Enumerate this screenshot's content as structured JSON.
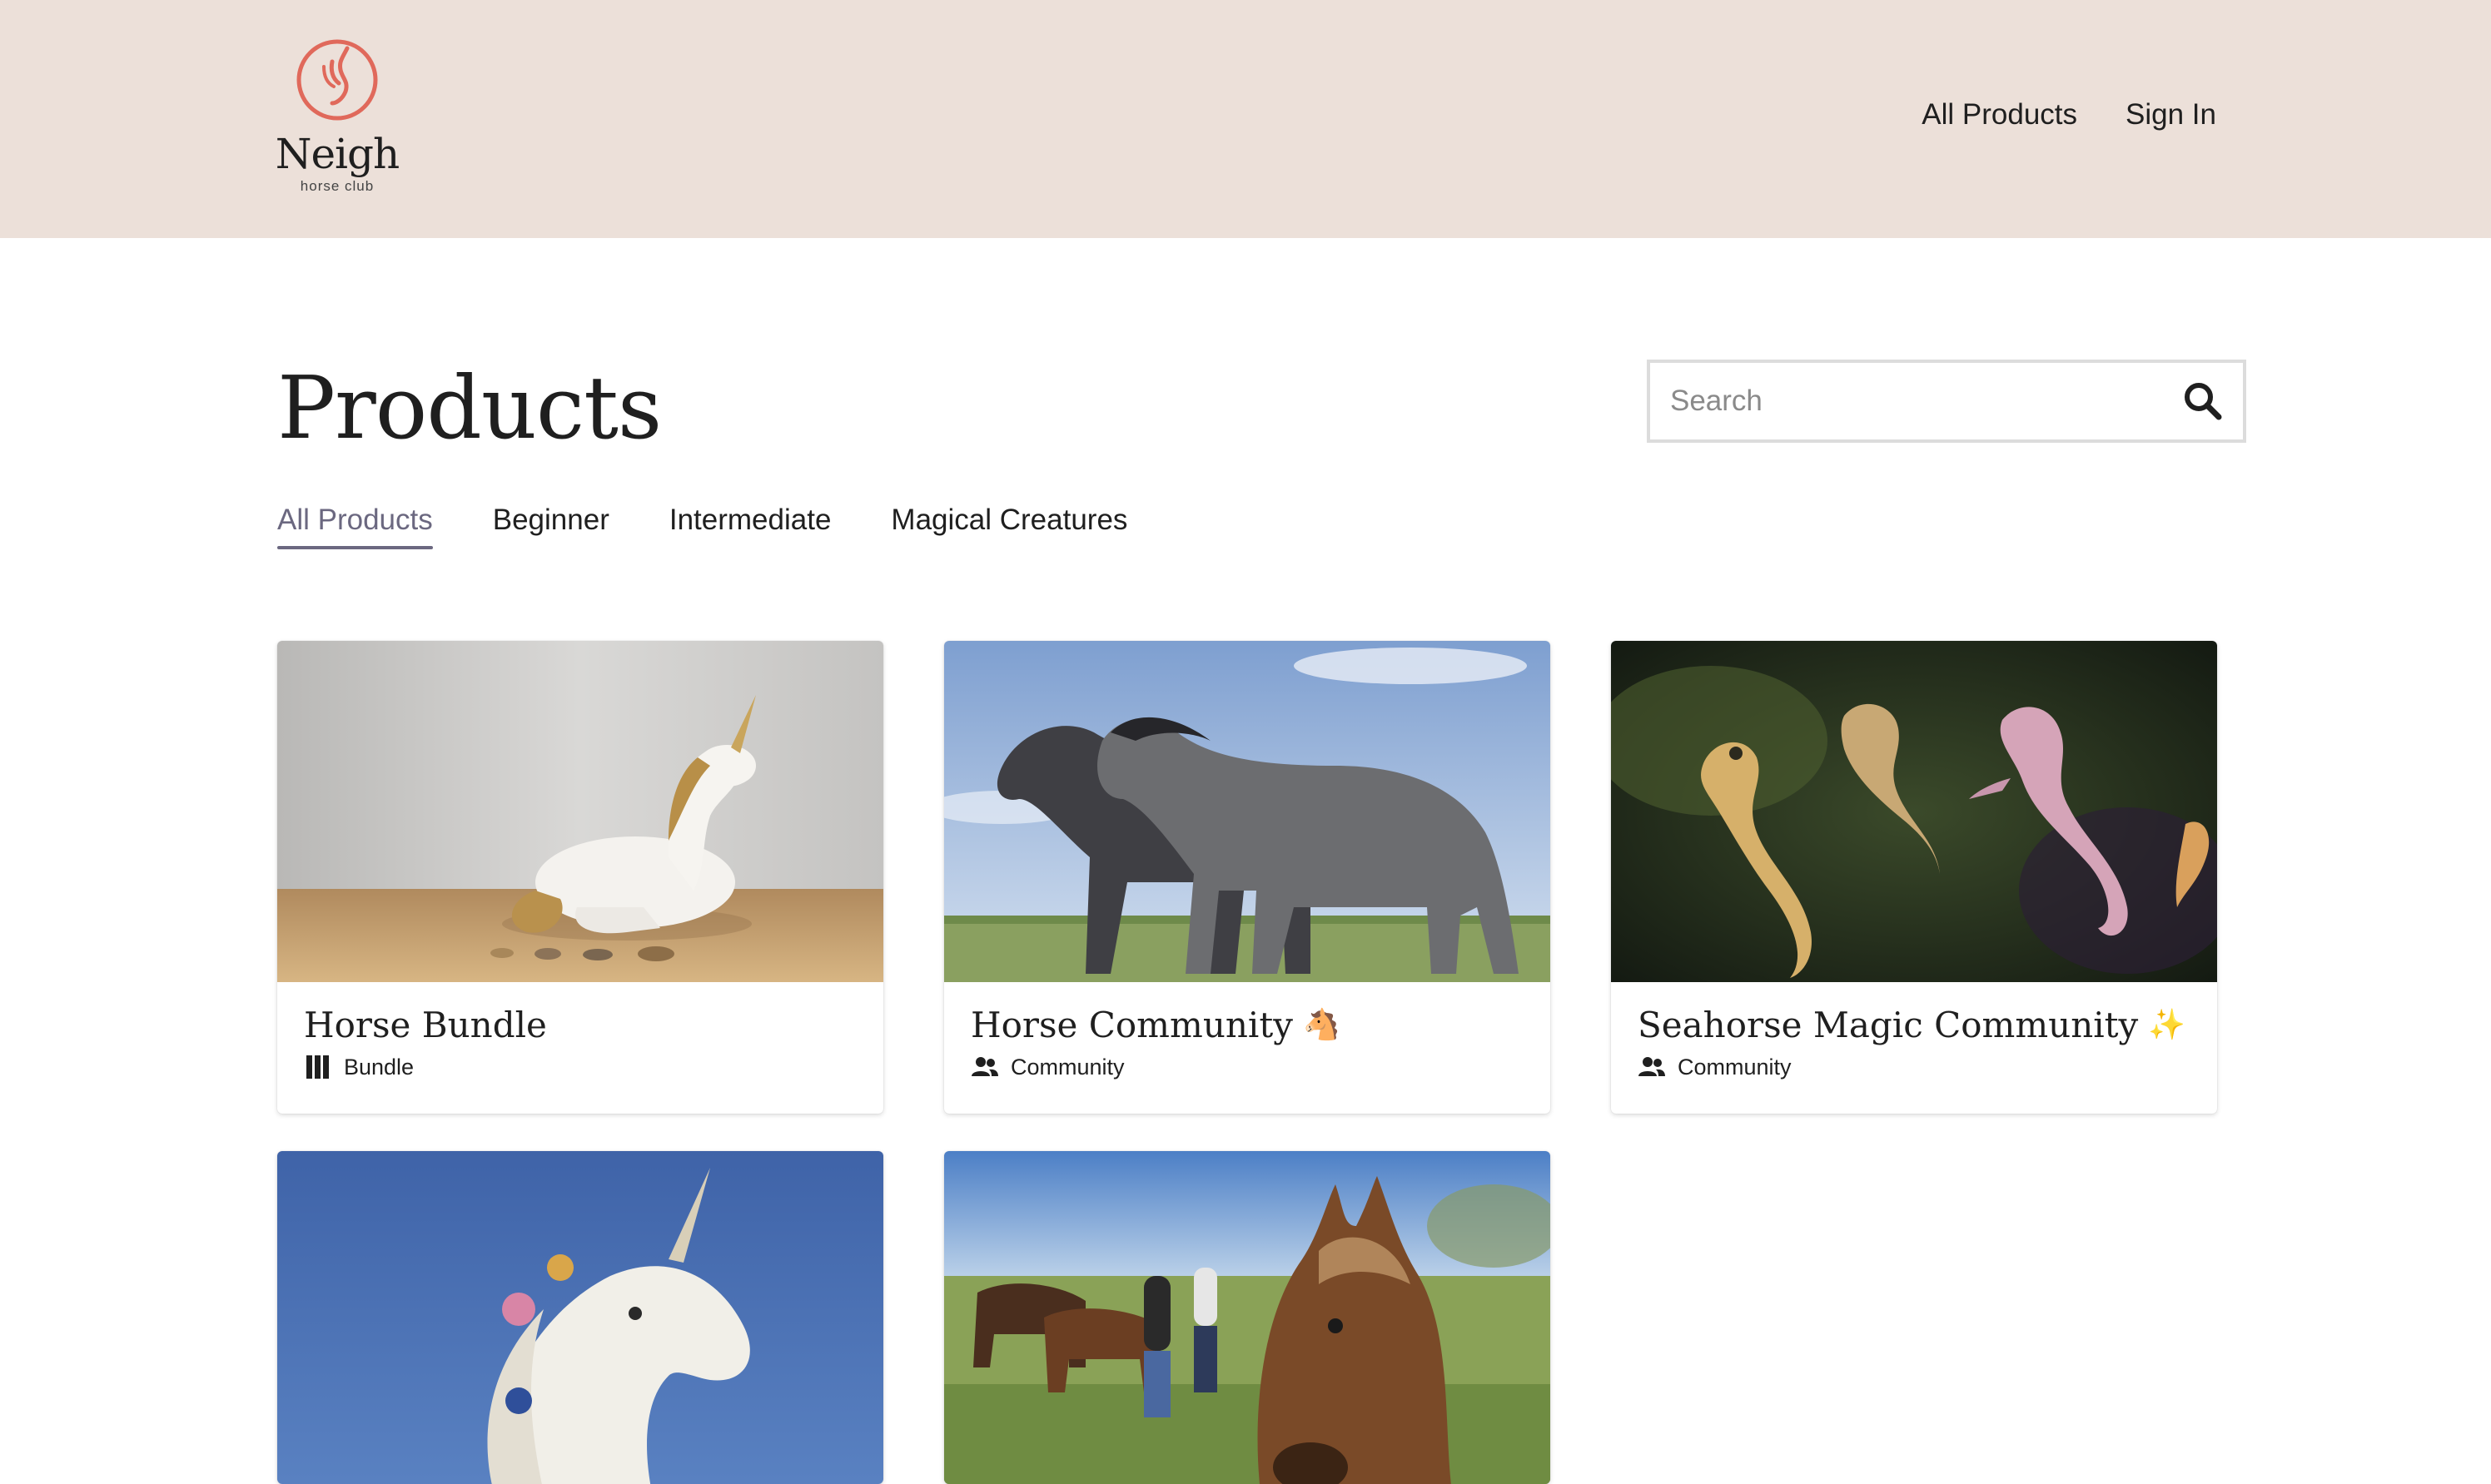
{
  "brand": {
    "name": "Neigh",
    "tagline": "horse club",
    "accent": "#e0695b"
  },
  "top_nav": {
    "items": [
      "All Products",
      "Sign In"
    ]
  },
  "page": {
    "title": "Products"
  },
  "search": {
    "placeholder": "Search",
    "value": "",
    "icon": "search-icon"
  },
  "tabs": [
    {
      "label": "All Products",
      "active": true
    },
    {
      "label": "Beginner",
      "active": false
    },
    {
      "label": "Intermediate",
      "active": false
    },
    {
      "label": "Magical Creatures",
      "active": false
    }
  ],
  "products": [
    {
      "title": "Horse Bundle",
      "emoji": "",
      "type": "Bundle",
      "type_icon": "bundle-icon",
      "image": "ceramic unicorn figurine with coins"
    },
    {
      "title": "Horse Community",
      "emoji": "🐴",
      "type": "Community",
      "type_icon": "people-icon",
      "image": "two dark horses in a grassy field"
    },
    {
      "title": "Seahorse Magic Community",
      "emoji": "✨",
      "type": "Community",
      "type_icon": "people-icon",
      "image": "seahorses underwater"
    },
    {
      "title": "",
      "emoji": "",
      "type": "",
      "type_icon": "",
      "image": "white unicorn statue with flowers against blue sky"
    },
    {
      "title": "",
      "emoji": "",
      "type": "",
      "type_icon": "",
      "image": "brown horse and riders in a pasture"
    }
  ],
  "colors": {
    "header_bg": "#ece0d9",
    "active_tab": "#6b6880",
    "text": "#1f1f1f"
  }
}
